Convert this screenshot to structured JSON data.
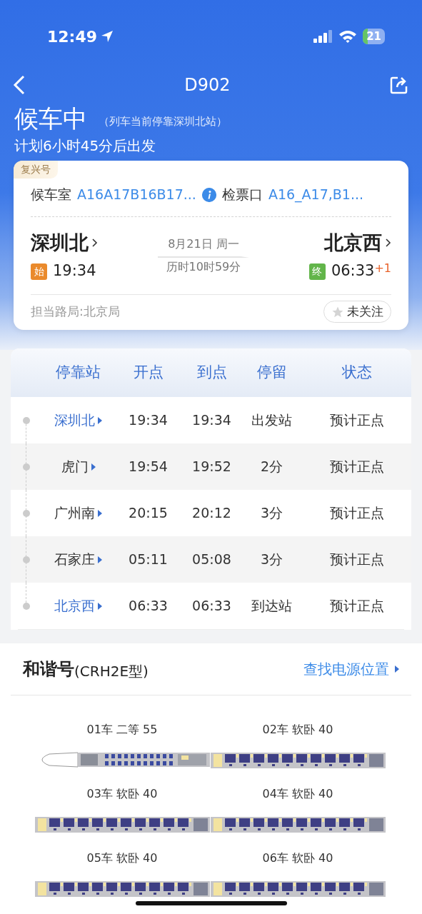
{
  "status_bar": {
    "time": "12:49",
    "battery": "21"
  },
  "nav": {
    "title": "D902"
  },
  "status": {
    "title": "候车中",
    "note": "（列车当前停靠深圳北站）",
    "plan": "计划6小时45分后出发"
  },
  "card": {
    "badge": "复兴号",
    "waiting_label": "候车室",
    "waiting_value": "A16A17B16B17...",
    "gate_label": "检票口",
    "gate_value": "A16_A17,B1...",
    "from": {
      "station": "深圳北",
      "tag": "始",
      "time": "19:34"
    },
    "date": "8月21日 周一",
    "duration": "历时10时59分",
    "to": {
      "station": "北京西",
      "tag": "终",
      "time": "06:33",
      "day_offset": "+1"
    },
    "bureau": "担当路局:北京局",
    "follow": {
      "label": "未关注",
      "on": false
    }
  },
  "stops": {
    "columns": [
      "停靠站",
      "开点",
      "到点",
      "停留",
      "状态"
    ],
    "rows": [
      {
        "station": "深圳北",
        "depart": "19:34",
        "arrive": "19:34",
        "stay": "出发站",
        "state": "预计正点",
        "terminal": true
      },
      {
        "station": "虎门",
        "depart": "19:54",
        "arrive": "19:52",
        "stay": "2分",
        "state": "预计正点",
        "terminal": false
      },
      {
        "station": "广州南",
        "depart": "20:15",
        "arrive": "20:12",
        "stay": "3分",
        "state": "预计正点",
        "terminal": false
      },
      {
        "station": "石家庄",
        "depart": "05:11",
        "arrive": "05:08",
        "stay": "3分",
        "state": "预计正点",
        "terminal": false
      },
      {
        "station": "北京西",
        "depart": "06:33",
        "arrive": "06:33",
        "stay": "到达站",
        "state": "预计正点",
        "terminal": true
      }
    ]
  },
  "train": {
    "name": "和谐号",
    "model": "(CRH2E型)",
    "link": "查找电源位置",
    "cars": [
      {
        "label": "01车 二等 55",
        "kind": "head"
      },
      {
        "label": "02车 软卧 40",
        "kind": "sleeper"
      },
      {
        "label": "03车 软卧 40",
        "kind": "sleeper"
      },
      {
        "label": "04车 软卧 40",
        "kind": "sleeper"
      },
      {
        "label": "05车 软卧 40",
        "kind": "sleeper"
      },
      {
        "label": "06车 软卧 40",
        "kind": "sleeper"
      }
    ]
  }
}
